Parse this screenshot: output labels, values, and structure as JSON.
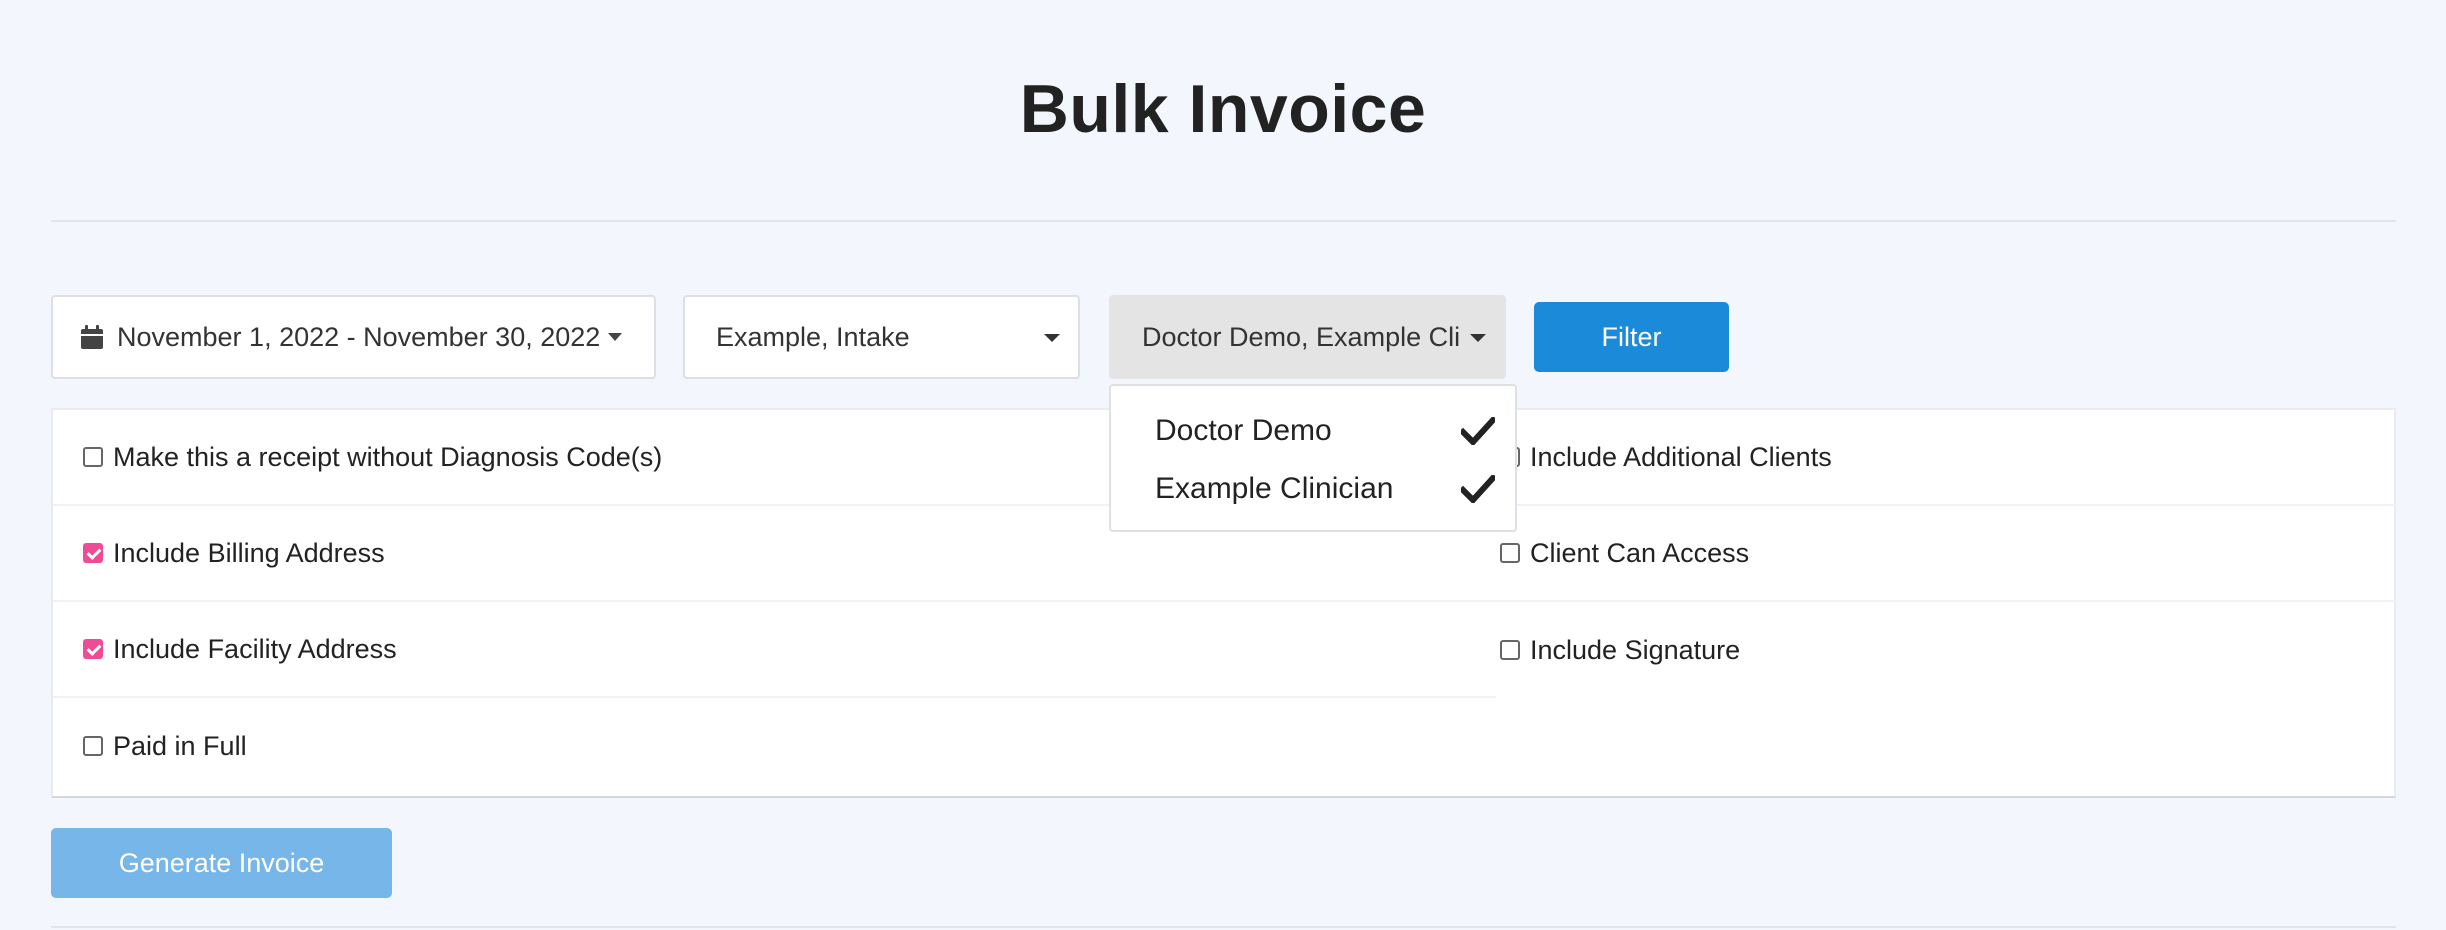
{
  "page": {
    "title": "Bulk Invoice"
  },
  "filters": {
    "date_range": "November 1, 2022 - November 30, 2022",
    "date_icon": "calendar-icon",
    "intake_select": "Example, Intake",
    "clinician_select": "Doctor Demo, Example Clinician",
    "filter_label": "Filter"
  },
  "clinician_dropdown": {
    "items": [
      {
        "label": "Doctor Demo",
        "selected": true,
        "icon": "checkmark-icon"
      },
      {
        "label": "Example Clinician",
        "selected": true,
        "icon": "checkmark-icon"
      }
    ]
  },
  "options": {
    "left": [
      {
        "label": "Make this a receipt without Diagnosis Code(s)",
        "checked": false
      },
      {
        "label": "Include Billing Address",
        "checked": true
      },
      {
        "label": "Include Facility Address",
        "checked": true
      },
      {
        "label": "Paid in Full",
        "checked": false
      }
    ],
    "right": [
      {
        "label": "Include Additional Clients",
        "checked": false
      },
      {
        "label": "Client Can Access",
        "checked": false
      },
      {
        "label": "Include Signature",
        "checked": false
      }
    ]
  },
  "actions": {
    "generate_label": "Generate Invoice"
  },
  "colors": {
    "background": "#f3f7fd",
    "primary_button": "#1a8ad9",
    "disabled_button": "#76b6e8",
    "checkbox_checked": "#ee4d96"
  }
}
